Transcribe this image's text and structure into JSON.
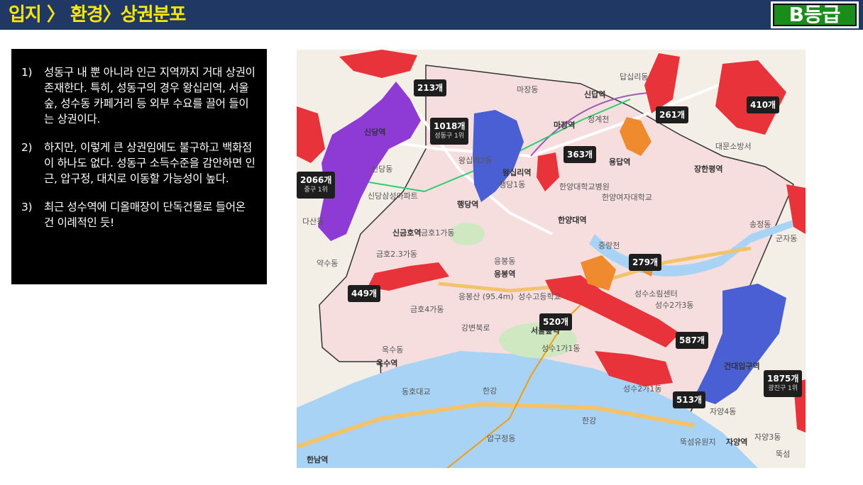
{
  "header": {
    "title": "입지 〉 환경〉상권분포",
    "grade": "B등급"
  },
  "notes": [
    {
      "num": "1)",
      "text": "성동구 내 뿐 아니라 인근 지역까지 거대 상권이 존재한다. 특히, 성동구의 경우 왕십리역, 서울숲, 성수동 카페거리 등 외부 수요를 끌어 들이는 상권이다."
    },
    {
      "num": "2)",
      "text": "하지만, 이렇게 큰 상권임에도 불구하고 백화점이 하나도 없다. 성동구 소득수준을 감안하면 인근, 압구정, 대치로 이동할 가능성이 높다."
    },
    {
      "num": "3)",
      "text": "최근 성수역에 디올매장이 단독건물로 들어온 건 이례적인 듯!"
    }
  ],
  "map": {
    "colors": {
      "red": "#e8333a",
      "purple": "#8e3bd6",
      "blue": "#4a5fd4",
      "orange": "#ef8a2e",
      "river": "#a9d3f5",
      "district": "#f6dede"
    },
    "tags": [
      {
        "count": "213개",
        "sub": ""
      },
      {
        "count": "1018개",
        "sub": "성동구 1위"
      },
      {
        "count": "363개",
        "sub": ""
      },
      {
        "count": "261개",
        "sub": ""
      },
      {
        "count": "410개",
        "sub": ""
      },
      {
        "count": "2066개",
        "sub": "중구 1위"
      },
      {
        "count": "279개",
        "sub": ""
      },
      {
        "count": "449개",
        "sub": ""
      },
      {
        "count": "520개",
        "sub": ""
      },
      {
        "count": "587개",
        "sub": ""
      },
      {
        "count": "513개",
        "sub": ""
      },
      {
        "count": "1875개",
        "sub": "광진구 1위"
      }
    ],
    "places": {
      "sindang": "신당역",
      "sindangdong": "신당동",
      "sindang_samsung": "신당삼성아파트",
      "wangsimni2": "왕십리2동",
      "wangsimni_station": "왕십리역",
      "haengdang1": "행당1동",
      "haengdang_station": "행당역",
      "majang_station": "마장역",
      "majangdong": "마장동",
      "sindap": "신답역",
      "yongdap": "용답역",
      "yongdapdong": "용답동",
      "janghanpyeong": "장한평역",
      "hanyang_univ": "한양대역",
      "hanyang_hospital": "한양대학교병원",
      "hanyang_women": "한양여자대학교",
      "eungbong": "응봉동",
      "eungbong_station": "응봉역",
      "eungbongsan": "응봉산 (95.4m)",
      "geumho_station": "신금호역",
      "geumho1": "금호1가동",
      "geumho23": "금호2.3가동",
      "geumho4": "금호4가동",
      "oksu": "옥수동",
      "oksu_station": "옥수역",
      "seoulsup_station": "서울숲역",
      "seongsu1": "성수1가1동",
      "seongsu2_1": "성수2가1동",
      "seongsu2_3": "성수2가3동",
      "seongsu_station": "성수역",
      "seongsu_center": "성수소림센터",
      "ttukseom": "뚝섬",
      "ttukseom_resort": "뚝섬유원지",
      "geondae": "건대입구역",
      "jayang": "자양역",
      "jayang3": "자양3동",
      "jayang4": "자양4동",
      "gunja": "군자동",
      "songjeong": "송정동",
      "dasan": "다산동",
      "yaksu": "약수동",
      "yaksu_station": "약수역",
      "hannam": "한남역",
      "apgujeong": "압구정동",
      "hanriver": "한강",
      "gangbyeon": "강변북로",
      "dongho": "동호대교",
      "dapsimni": "답십리동",
      "cheonggye": "청계천",
      "jungnangcheon": "중랑천",
      "daemunsobang": "대문소방서",
      "seongdong_high": "성수고등학교",
      "munhwa": "문화동"
    }
  }
}
